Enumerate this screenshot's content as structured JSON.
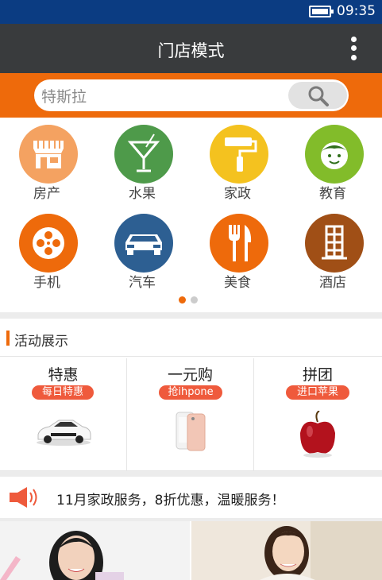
{
  "status_bar": {
    "time": "09:35",
    "battery_level": 1.0
  },
  "header": {
    "title": "门店模式",
    "menu_icon": "more-vertical-icon"
  },
  "search": {
    "value": "特斯拉",
    "button_icon": "search-icon"
  },
  "categories": [
    {
      "label": "房产",
      "icon": "storefront-icon",
      "color": "#f4a261"
    },
    {
      "label": "水果",
      "icon": "cocktail-icon",
      "color": "#4e9a4a"
    },
    {
      "label": "家政",
      "icon": "paint-roller-icon",
      "color": "#f4c21f"
    },
    {
      "label": "教育",
      "icon": "child-face-icon",
      "color": "#82bc2a"
    },
    {
      "label": "手机",
      "icon": "film-reel-icon",
      "color": "#ee6a0b"
    },
    {
      "label": "汽车",
      "icon": "car-icon",
      "color": "#2d5f92"
    },
    {
      "label": "美食",
      "icon": "fork-knife-icon",
      "color": "#ee6a0b"
    },
    {
      "label": "酒店",
      "icon": "building-icon",
      "color": "#a04f16"
    }
  ],
  "pager": {
    "count": 2,
    "active": 0,
    "active_color": "#ee6a0b",
    "inactive_color": "#cccccc"
  },
  "activity_section": {
    "title": "活动展示",
    "items": [
      {
        "title": "特惠",
        "badge": "每日特惠",
        "image": "white-sports-car"
      },
      {
        "title": "一元购",
        "badge": "抢ihpone",
        "image": "rose-gold-phone"
      },
      {
        "title": "拼团",
        "badge": "进口苹果",
        "image": "red-apple"
      }
    ]
  },
  "notice": {
    "icon": "speaker-icon",
    "text": "11月家政服务，8折优惠，温暖服务！"
  },
  "banners": [
    {
      "image": "smiling-woman-photo"
    },
    {
      "image": "woman-at-desk-photo"
    }
  ],
  "colors": {
    "accent": "#ee6a0b",
    "status_bar": "#0b3c82",
    "app_bar": "#393b3d"
  }
}
